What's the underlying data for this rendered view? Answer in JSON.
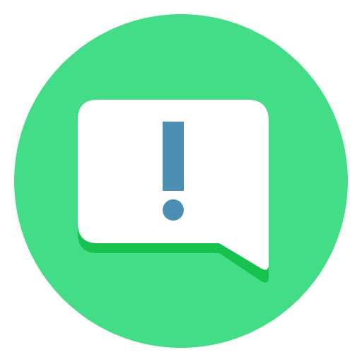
{
  "icon": {
    "name": "message-alert-icon",
    "colors": {
      "background": "#ffffff",
      "circle": "#42dd86",
      "bubble": "#ffffff",
      "bubble_shadow": "#17c14d",
      "exclamation": "#4b8fb3"
    }
  }
}
